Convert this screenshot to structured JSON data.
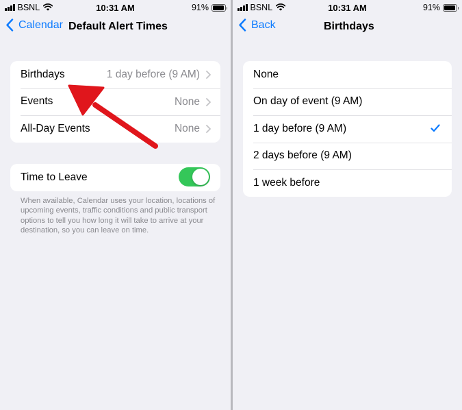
{
  "status": {
    "carrier": "BSNL",
    "time": "10:31 AM",
    "battery": "91%",
    "battery_level": 0.91
  },
  "left": {
    "back_label": "Calendar",
    "title": "Default Alert Times",
    "rows": [
      {
        "label": "Birthdays",
        "value": "1 day before (9 AM)"
      },
      {
        "label": "Events",
        "value": "None"
      },
      {
        "label": "All-Day Events",
        "value": "None"
      }
    ],
    "time_to_leave": {
      "label": "Time to Leave",
      "enabled": true
    },
    "footer": "When available, Calendar uses your location, locations of upcoming events, traffic conditions and public transport options to tell you how long it will take to arrive at your destination, so you can leave on time."
  },
  "right": {
    "back_label": "Back",
    "title": "Birthdays",
    "options": [
      {
        "label": "None",
        "selected": false
      },
      {
        "label": "On day of event (9 AM)",
        "selected": false
      },
      {
        "label": "1 day before (9 AM)",
        "selected": true
      },
      {
        "label": "2 days before (9 AM)",
        "selected": false
      },
      {
        "label": "1 week before",
        "selected": false
      }
    ]
  },
  "colors": {
    "accent": "#0a7aff",
    "toggle_on": "#34c759",
    "annotation_arrow": "#e0161c",
    "secondary_text": "#8a8a8f",
    "background": "#f0f0f5"
  },
  "icons": [
    "signal-icon",
    "wifi-icon",
    "battery-icon",
    "back-chevron-icon",
    "chevron-right-icon",
    "checkmark-icon",
    "annotation-arrow-icon"
  ]
}
